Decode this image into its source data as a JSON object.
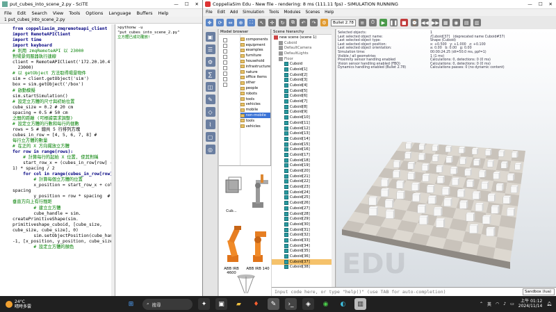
{
  "scite": {
    "title": "put_cubes_into_scene_2.py - SciTE",
    "menu": [
      "File",
      "Edit",
      "Search",
      "View",
      "Tools",
      "Options",
      "Language",
      "Buffers",
      "Help"
    ],
    "tab": "1 put_cubes_into_scene_2.py",
    "code": [
      {
        "t": "from coppeliasim_zmqremoteapi_client",
        "c": "kw"
      },
      {
        "t": "import RemoteAPIClient",
        "c": "kw"
      },
      {
        "t": "import time",
        "c": "kw"
      },
      {
        "t": "import keyboard",
        "c": "kw"
      },
      {
        "t": "",
        "c": ""
      },
      {
        "t": "# 利用 zmqRemoteAPI 以 23000",
        "c": "cm"
      },
      {
        "t": "對場景伺服器執行連線",
        "c": "cm"
      },
      {
        "t": "client = RemoteAPIClient('172.20.10.4',",
        "c": ""
      },
      {
        "t": "  23000)",
        "c": ""
      },
      {
        "t": "# 以 getObject 方法取得場景物件",
        "c": "cm"
      },
      {
        "t": "sim = client.getObject('sim')",
        "c": ""
      },
      {
        "t": "box = sim.getObject('/box')",
        "c": ""
      },
      {
        "t": "",
        "c": ""
      },
      {
        "t": "# 啟動模擬",
        "c": "cm"
      },
      {
        "t": "sim.startSimulation()",
        "c": ""
      },
      {
        "t": "",
        "c": ""
      },
      {
        "t": "# 設定立方體的尺寸與初始位置",
        "c": "cm"
      },
      {
        "t": "cube_size = 0.2 # 20 cm",
        "c": ""
      },
      {
        "t": "spacing = 0.5 # 50 cm",
        "c": ""
      },
      {
        "t": "之間的距離 (可根據需求調整)",
        "c": "cm"
      },
      {
        "t": "",
        "c": ""
      },
      {
        "t": "# 設定立方體的行數和每行的個數",
        "c": "cm"
      },
      {
        "t": "rows = 5 # 總共 5 行排列方塊",
        "c": ""
      },
      {
        "t": "cubes_in_row = [4, 5, 6, 7, 8] #",
        "c": ""
      },
      {
        "t": "每行立方體的數量",
        "c": "cm"
      },
      {
        "t": "",
        "c": ""
      },
      {
        "t": "# 在正的 X 方向擺放立方體",
        "c": "cm"
      },
      {
        "t": "for row in range(rows):",
        "c": "kw"
      },
      {
        "t": "    # 計算每行的起始 X 位置, 使其對稱",
        "c": "cm"
      },
      {
        "t": "    start_row_x = (cubes_in_row[row] -",
        "c": ""
      },
      {
        "t": "1) * spacing / 2",
        "c": ""
      },
      {
        "t": "",
        "c": ""
      },
      {
        "t": "    for col in range(cubes_in_row[row]):",
        "c": "kw"
      },
      {
        "t": "        # 計算每個立方體的位置",
        "c": "cm"
      },
      {
        "t": "        x_position = start_row_x + col *",
        "c": ""
      },
      {
        "t": "spacing",
        "c": ""
      },
      {
        "t": "        y_position = row * spacing  #",
        "c": ""
      },
      {
        "t": "垂直方向上有行間距",
        "c": "cm"
      },
      {
        "t": "",
        "c": ""
      },
      {
        "t": "        # 建立立方體",
        "c": "cm"
      },
      {
        "t": "        cube_handle = sim.",
        "c": ""
      },
      {
        "t": "createPrimitiveShape(sim.",
        "c": ""
      },
      {
        "t": "primitiveshape_cuboid, [cube_size,",
        "c": ""
      },
      {
        "t": "cube_size, cube_size], 0)",
        "c": ""
      },
      {
        "t": "        sim.setObjectPosition(cube_handle,",
        "c": ""
      },
      {
        "t": "-1, [x_position, y_position, cube_size / 2",
        "c": ""
      },
      {
        "t": "        # 設定立方體的顏色",
        "c": "cm"
      }
    ],
    "output": [
      ">pythonw -u \"put_cubes_into_scene_2.py\"",
      "立方體已成功擺放!"
    ]
  },
  "coppelia": {
    "title": "CoppeliaSim Edu - New file - rendering: 8 ms (111.11 fps) - SIMULATION RUNNING",
    "menu": [
      "File",
      "Edit",
      "Add",
      "Simulation",
      "Tools",
      "Modules",
      "Scenes",
      "Help"
    ],
    "engine": "Bullet 2.78",
    "model_browser_label": "Model browser",
    "folders": [
      "components",
      "equipment",
      "examples",
      "furniture",
      "household",
      "infrastructure",
      "nature",
      "office items",
      "other",
      "people",
      "robots",
      "tools",
      "vehicles",
      "mobile",
      "non-mobile",
      "tools",
      "vehicles"
    ],
    "selected_folder_index": 14,
    "thumbs": [
      {
        "name": "Cub..."
      },
      {
        "name": "ABB IRB 4600"
      },
      {
        "name": "ABB IRB 140"
      },
      {
        "name": "Delta"
      }
    ],
    "scene_label": "Scene hierarchy",
    "hierarchy_top": [
      "new scene (scene 1)",
      "Cuboid",
      "DefaultCamera",
      "DefaultLights",
      "Floor"
    ],
    "cubes": [
      "Cuboid",
      "Cuboid[1]",
      "Cuboid[2]",
      "Cuboid[3]",
      "Cuboid[4]",
      "Cuboid[5]",
      "Cuboid[6]",
      "Cuboid[7]",
      "Cuboid[8]",
      "Cuboid[9]",
      "Cuboid[10]",
      "Cuboid[11]",
      "Cuboid[12]",
      "Cuboid[13]",
      "Cuboid[14]",
      "Cuboid[15]",
      "Cuboid[16]",
      "Cuboid[17]",
      "Cuboid[18]",
      "Cuboid[19]",
      "Cuboid[20]",
      "Cuboid[21]",
      "Cuboid[22]",
      "Cuboid[23]",
      "Cuboid[24]",
      "Cuboid[25]",
      "Cuboid[26]",
      "Cuboid[27]",
      "Cuboid[28]",
      "Cuboid[29]",
      "Cuboid[30]",
      "Cuboid[31]",
      "Cuboid[32]",
      "Cuboid[33]",
      "Cuboid[34]",
      "Cuboid[35]",
      "Cuboid[36]",
      "Cuboid[37]",
      "Cuboid[38]"
    ],
    "selected_cube": "Cuboid[37]",
    "info_left": [
      "Selected objects:",
      "Last selected object name:",
      "Last selected object type:",
      "Last selected object position:",
      "Last selected object orientation:",
      "Simulation time:",
      "Visible / all geometries",
      "Proximity sensor handling enabled",
      "Vision sensor handling enabled (FBO)",
      "Dynamics handling enabled (Bullet 2.78)"
    ],
    "info_right": [
      "1",
      "/Cuboid[37]   (deprecated name Cuboid#37)",
      "Shape (Cuboid)",
      "x: +0.500   y: +1.000   z: +0.100",
      "a: 0.00   b: 0.00   g: 0.00",
      "00:00:24.25 (dt=50.0 ms, ppf=1)",
      "1 (1 ms)",
      "Calculations: 0, detections: 0 (0 ms)",
      "Calculations: 0, detections: 0 (0 ms)",
      "Calculations passes: 0 (no dynamic content)"
    ],
    "watermark": "EDU",
    "status_lines": [
      "ZMQ endpoint on port 23020...",
      "[sandboxScript:info] Simulation started."
    ],
    "cmd_placeholder": "Input code here, or type \"help()\" (use TAB for auto-completion)",
    "cmd_select": "Sandbox (lua)"
  },
  "taskbar": {
    "temp": "24°C",
    "weather": "晴時多雲",
    "search": "搜尋",
    "ime": "英",
    "time": "上午 01:12",
    "date": "2024/11/14"
  }
}
